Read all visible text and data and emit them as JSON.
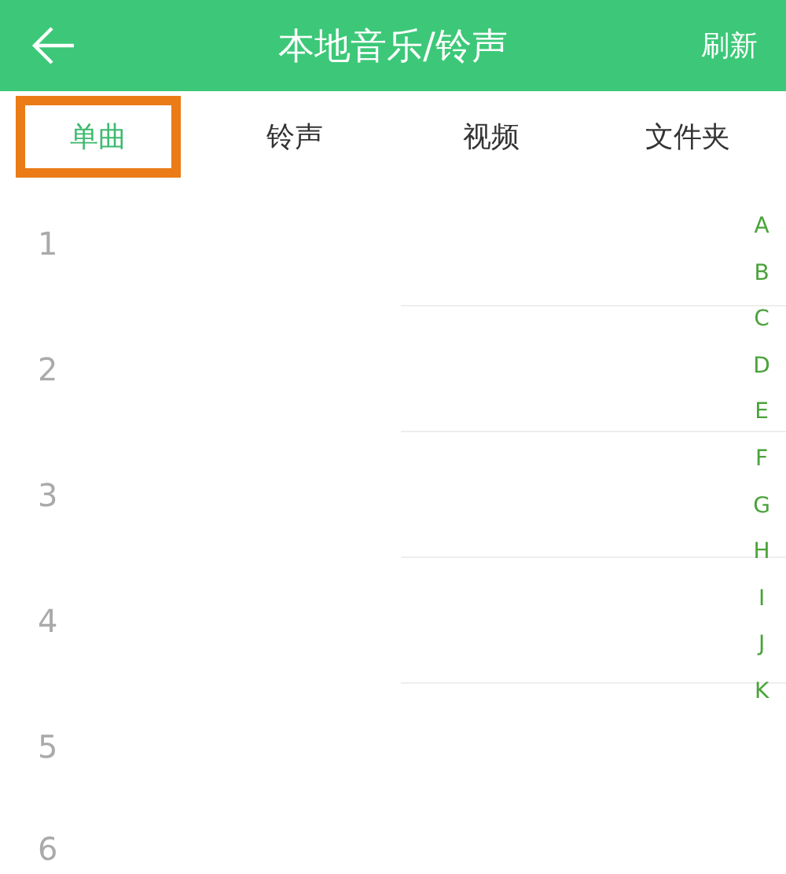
{
  "header": {
    "title": "本地音乐/铃声",
    "action": "刷新"
  },
  "tabs": [
    {
      "label": "单曲",
      "selected": true,
      "highlighted": true
    },
    {
      "label": "铃声",
      "selected": false,
      "highlighted": false
    },
    {
      "label": "视频",
      "selected": false,
      "highlighted": false
    },
    {
      "label": "文件夹",
      "selected": false,
      "highlighted": false
    }
  ],
  "rows": [
    "1",
    "2",
    "3",
    "4",
    "5",
    "6"
  ],
  "index": [
    "A",
    "B",
    "C",
    "D",
    "E",
    "F",
    "G",
    "H",
    "I",
    "J",
    "K"
  ]
}
